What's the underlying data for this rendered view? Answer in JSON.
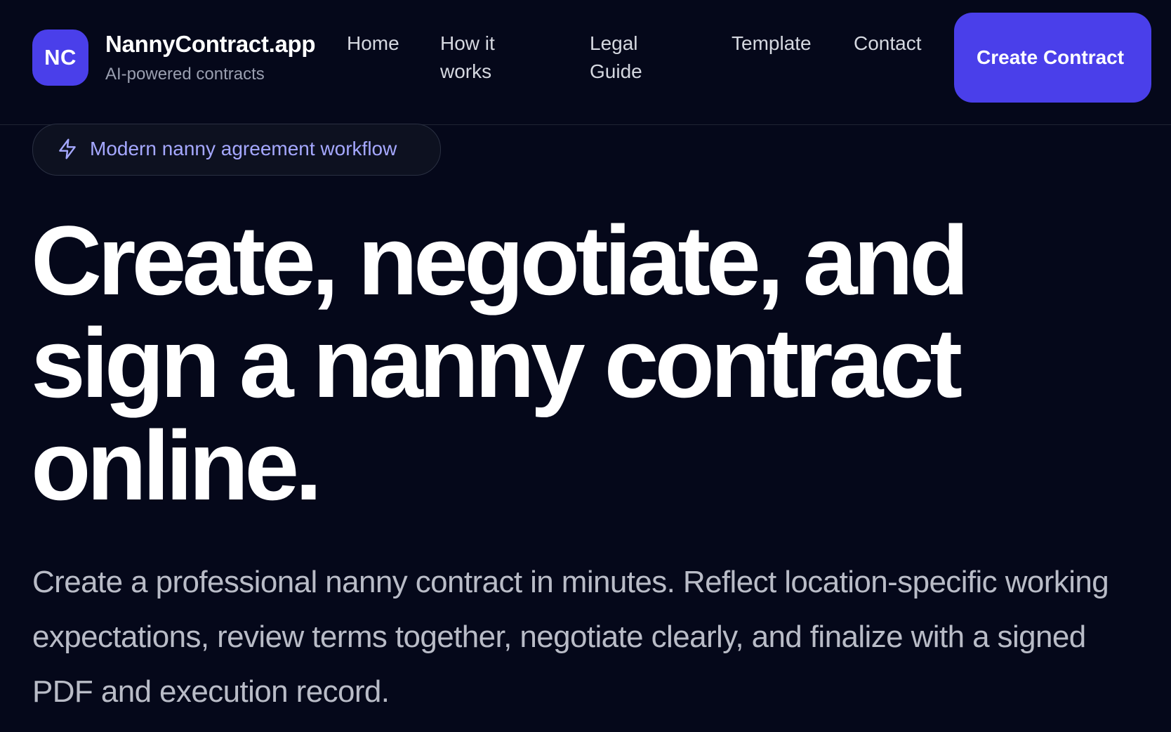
{
  "brand": {
    "logo_initials": "NC",
    "name": "NannyContract.app",
    "tagline": "AI-powered contracts"
  },
  "nav": {
    "home": "Home",
    "how_it_works": "How it works",
    "legal_guide": "Legal Guide",
    "template": "Template",
    "contact": "Contact",
    "cta": "Create Contract"
  },
  "badge": {
    "icon": "lightning-bolt-icon",
    "text": "Modern nanny agreement workflow"
  },
  "hero": {
    "title": "Create, negotiate, and sign a nanny contract online.",
    "subtitle": "Create a professional nanny contract in minutes. Reflect location-specific working expectations, review terms together, negotiate clearly, and finalize with a signed PDF and execution record."
  },
  "colors": {
    "background": "#05081a",
    "accent": "#4a3fea",
    "badge_text": "#a5a8ff",
    "subtitle_text": "#b9bcc7"
  }
}
